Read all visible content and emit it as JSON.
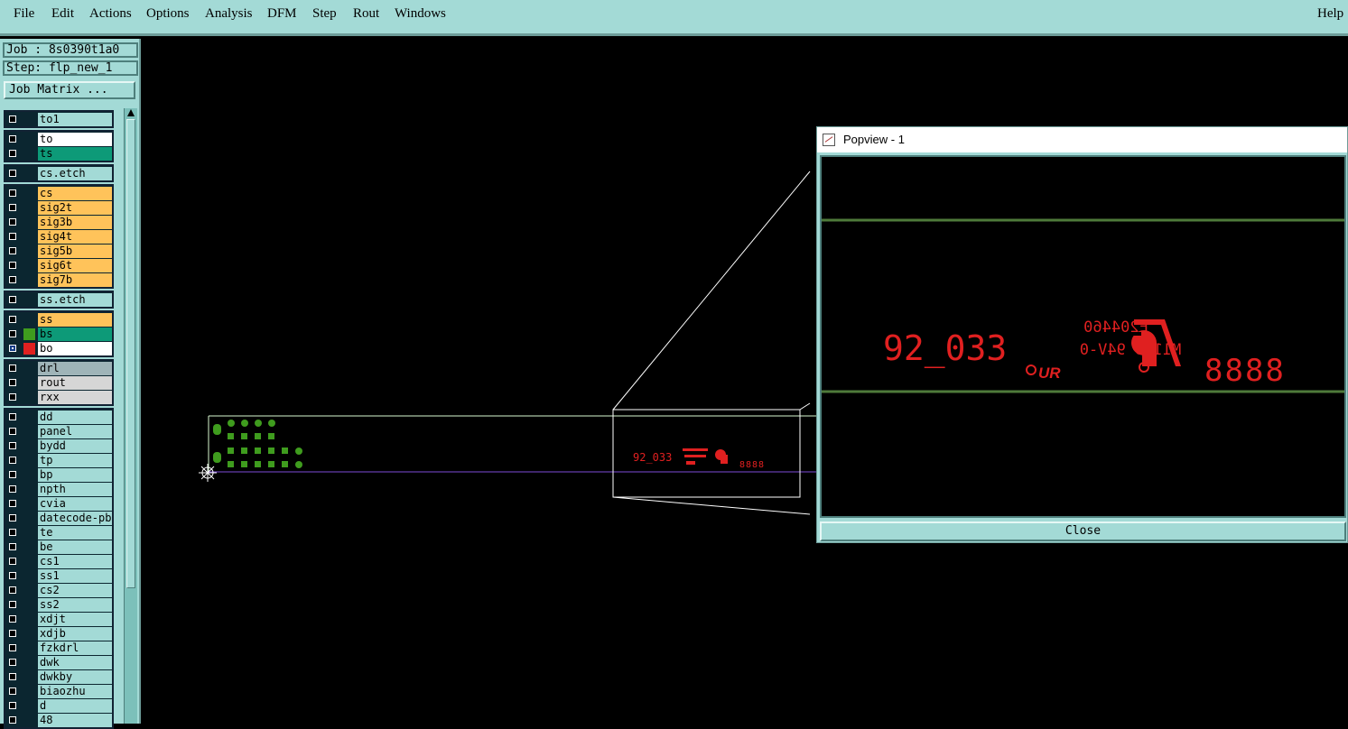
{
  "menu": {
    "file": "File",
    "edit": "Edit",
    "actions": "Actions",
    "options": "Options",
    "analysis": "Analysis",
    "dfm": "DFM",
    "step": "Step",
    "rout": "Rout",
    "windows": "Windows",
    "help": "Help"
  },
  "panel": {
    "job": "Job : 8s0390t1a0",
    "step": "Step: flp_new_1",
    "job_matrix": "Job Matrix ..."
  },
  "layers": [
    {
      "name": "to1",
      "bg": "#a3dad6"
    },
    {
      "name": "to",
      "bg": "#ffffff"
    },
    {
      "name": "ts",
      "bg": "#0d9a78"
    },
    {
      "name": "cs.etch",
      "bg": "#a3dad6"
    },
    {
      "name": "cs",
      "bg": "#ffc35a"
    },
    {
      "name": "sig2t",
      "bg": "#ffc35a"
    },
    {
      "name": "sig3b",
      "bg": "#ffc35a"
    },
    {
      "name": "sig4t",
      "bg": "#ffc35a"
    },
    {
      "name": "sig5b",
      "bg": "#ffc35a"
    },
    {
      "name": "sig6t",
      "bg": "#ffc35a"
    },
    {
      "name": "sig7b",
      "bg": "#ffc35a"
    },
    {
      "name": "ss.etch",
      "bg": "#a3dad6"
    },
    {
      "name": "ss",
      "bg": "#ffc35a"
    },
    {
      "name": "bs",
      "bg": "#0d9a78"
    },
    {
      "name": "bo",
      "bg": "#ffffff"
    },
    {
      "name": "drl",
      "bg": "#9fb4b8"
    },
    {
      "name": "rout",
      "bg": "#d6d6d6"
    },
    {
      "name": "rxx",
      "bg": "#d6d6d6"
    },
    {
      "name": "dd",
      "bg": "#a3dad6"
    },
    {
      "name": "panel",
      "bg": "#a3dad6"
    },
    {
      "name": "bydd",
      "bg": "#a3dad6"
    },
    {
      "name": "tp",
      "bg": "#a3dad6"
    },
    {
      "name": "bp",
      "bg": "#a3dad6"
    },
    {
      "name": "npth",
      "bg": "#a3dad6"
    },
    {
      "name": "cvia",
      "bg": "#a3dad6"
    },
    {
      "name": "datecode-pb",
      "bg": "#a3dad6"
    },
    {
      "name": "te",
      "bg": "#a3dad6"
    },
    {
      "name": "be",
      "bg": "#a3dad6"
    },
    {
      "name": "cs1",
      "bg": "#a3dad6"
    },
    {
      "name": "ss1",
      "bg": "#a3dad6"
    },
    {
      "name": "cs2",
      "bg": "#a3dad6"
    },
    {
      "name": "ss2",
      "bg": "#a3dad6"
    },
    {
      "name": "xdjt",
      "bg": "#a3dad6"
    },
    {
      "name": "xdjb",
      "bg": "#a3dad6"
    },
    {
      "name": "fzkdrl",
      "bg": "#a3dad6"
    },
    {
      "name": "dwk",
      "bg": "#a3dad6"
    },
    {
      "name": "dwkby",
      "bg": "#a3dad6"
    },
    {
      "name": "biaozhu",
      "bg": "#a3dad6"
    },
    {
      "name": "d",
      "bg": "#a3dad6"
    },
    {
      "name": "48",
      "bg": "#a3dad6"
    }
  ],
  "popview": {
    "title": "Popview - 1",
    "close_label": "Close",
    "code_text": "92_033",
    "mirror_line1": "E204460",
    "mirror_line2": "M11 S 94V-0",
    "digits_text": "8888"
  },
  "canvas": {
    "small_code_text": "92_033",
    "small_digits_text": "8888"
  },
  "colors": {
    "ui_teal": "#a3dad6",
    "pad_green": "#3f9c1e",
    "silk_red": "#e02020",
    "profile_purple": "#7b4bd6"
  }
}
